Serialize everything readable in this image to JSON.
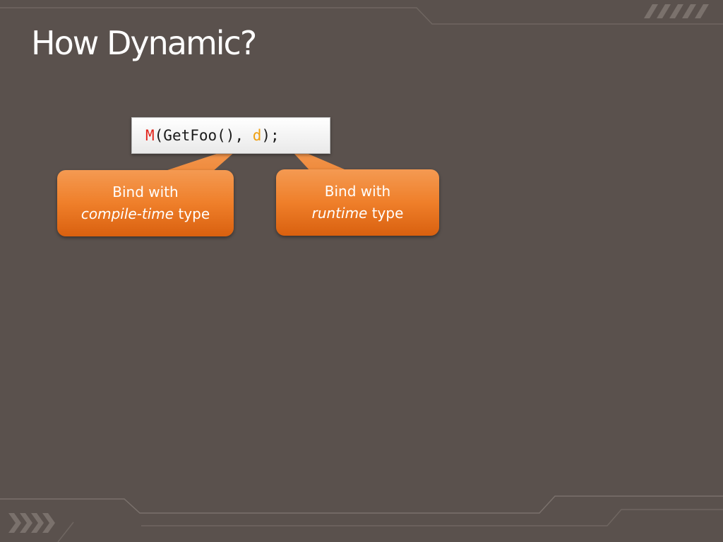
{
  "slide": {
    "title": "How Dynamic?",
    "code": {
      "method": "M",
      "args_open": "(GetFoo(), ",
      "dynamic_var": "d",
      "close": ");"
    },
    "callouts": {
      "left": {
        "line1": "Bind with",
        "emphasis": "compile-time",
        "suffix": " type"
      },
      "right": {
        "line1": "Bind with",
        "emphasis": "runtime",
        "suffix": " type"
      }
    },
    "colors": {
      "background": "#5a514d",
      "callout_orange": "#ef7f2a",
      "code_method": "#e2231a",
      "code_dynamic": "#f0a010"
    }
  }
}
